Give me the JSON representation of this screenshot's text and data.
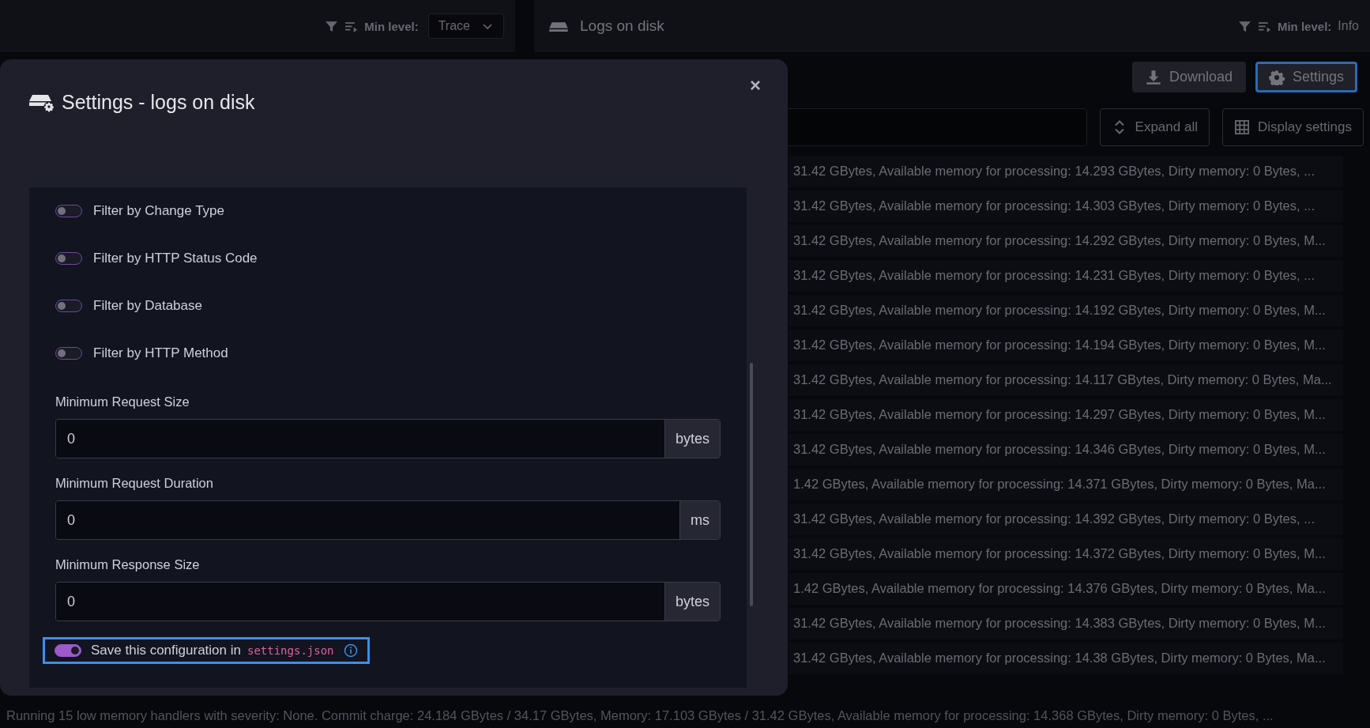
{
  "left_panel": {
    "min_level_label": "Min level:",
    "min_level_value": "Trace"
  },
  "right_panel": {
    "title": "Logs on disk",
    "min_level_label": "Min level:",
    "min_level_value": "Info",
    "buttons": [
      {
        "kind": "download",
        "label": "Download",
        "focused": false
      },
      {
        "kind": "settings",
        "label": "Settings",
        "focused": true
      }
    ],
    "expand_all": "Expand all",
    "display_settings": "Display settings",
    "log_rows": [
      "31.42 GBytes, Available memory for processing: 14.293 GBytes, Dirty memory: 0 Bytes, ...",
      "31.42 GBytes, Available memory for processing: 14.303 GBytes, Dirty memory: 0 Bytes, ...",
      "31.42 GBytes, Available memory for processing: 14.292 GBytes, Dirty memory: 0 Bytes, M...",
      "31.42 GBytes, Available memory for processing: 14.231 GBytes, Dirty memory: 0 Bytes, ...",
      "31.42 GBytes, Available memory for processing: 14.192 GBytes, Dirty memory: 0 Bytes, M...",
      "31.42 GBytes, Available memory for processing: 14.194 GBytes, Dirty memory: 0 Bytes, M...",
      "31.42 GBytes, Available memory for processing: 14.117 GBytes, Dirty memory: 0 Bytes, Ma...",
      "31.42 GBytes, Available memory for processing: 14.297 GBytes, Dirty memory: 0 Bytes, M...",
      "31.42 GBytes, Available memory for processing: 14.346 GBytes, Dirty memory: 0 Bytes, M...",
      "1.42 GBytes, Available memory for processing: 14.371 GBytes, Dirty memory: 0 Bytes, Ma...",
      "31.42 GBytes, Available memory for processing: 14.392 GBytes, Dirty memory: 0 Bytes, ...",
      "31.42 GBytes, Available memory for processing: 14.372 GBytes, Dirty memory: 0 Bytes, M...",
      "1.42 GBytes, Available memory for processing: 14.376 GBytes, Dirty memory: 0 Bytes, Ma...",
      "31.42 GBytes, Available memory for processing: 14.383 GBytes, Dirty memory: 0 Bytes, M...",
      "31.42 GBytes, Available memory for processing: 14.38 GBytes, Dirty memory: 0 Bytes, Ma..."
    ]
  },
  "status_line": "Running 15 low memory handlers with severity: None. Commit charge: 24.184 GBytes / 34.17 GBytes, Memory: 17.103 GBytes / 31.42 GBytes, Available memory for processing: 14.368 GBytes, Dirty memory: 0 Bytes, ...",
  "modal": {
    "title": "Settings - logs on disk",
    "close": "×",
    "toggles": [
      {
        "label": "Filter by Change Type",
        "on": false
      },
      {
        "label": "Filter by HTTP Status Code",
        "on": false
      },
      {
        "label": "Filter by Database",
        "on": false
      },
      {
        "label": "Filter by HTTP Method",
        "on": false
      }
    ],
    "fields": [
      {
        "label": "Minimum Request Size",
        "value": "0",
        "unit": "bytes"
      },
      {
        "label": "Minimum Request Duration",
        "value": "0",
        "unit": "ms"
      },
      {
        "label": "Minimum Response Size",
        "value": "0",
        "unit": "bytes"
      }
    ],
    "save": {
      "text": "Save this configuration in",
      "code": "settings.json",
      "on": true,
      "focused": true
    }
  }
}
